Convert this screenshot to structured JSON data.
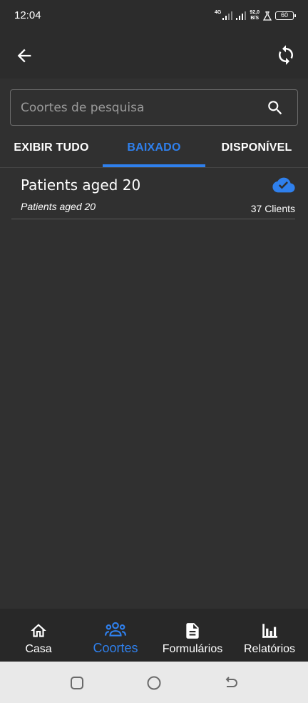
{
  "status_bar": {
    "time": "12:04",
    "network_label": "4G",
    "speed_value": "92,0",
    "speed_unit": "B/S",
    "battery": "60"
  },
  "search": {
    "placeholder": "Coortes de pesquisa",
    "value": ""
  },
  "tabs": [
    {
      "label": "EXIBIR TUDO",
      "active": false
    },
    {
      "label": "BAIXADO",
      "active": true
    },
    {
      "label": "DISPONÍVEL",
      "active": false
    }
  ],
  "cohorts": [
    {
      "title": "Patients aged 20",
      "subtitle": "Patients aged 20",
      "count": "37 Clients",
      "status_icon": "cloud-done-icon"
    }
  ],
  "bottom_nav": [
    {
      "label": "Casa",
      "icon": "home-icon",
      "active": false
    },
    {
      "label": "Coortes",
      "icon": "people-icon",
      "active": true
    },
    {
      "label": "Formulários",
      "icon": "document-icon",
      "active": false
    },
    {
      "label": "Relatórios",
      "icon": "bar-chart-icon",
      "active": false
    }
  ],
  "colors": {
    "accent": "#2f80ed",
    "background": "#303030",
    "bar": "#2c2c2c"
  }
}
